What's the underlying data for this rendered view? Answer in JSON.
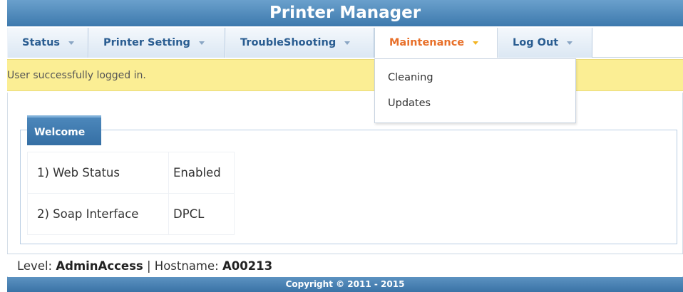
{
  "header": {
    "title": "Printer Manager"
  },
  "nav": {
    "tabs": [
      {
        "label": "Status"
      },
      {
        "label": "Printer Setting"
      },
      {
        "label": "TroubleShooting"
      },
      {
        "label": "Maintenance"
      },
      {
        "label": "Log Out"
      }
    ],
    "active_tab": "Maintenance"
  },
  "dropdown": {
    "items": [
      {
        "label": "Cleaning"
      },
      {
        "label": "Updates"
      }
    ]
  },
  "alert": {
    "message": "User successfully logged in."
  },
  "welcome": {
    "title": "Welcome",
    "rows": [
      {
        "label": "1) Web Status",
        "value": "Enabled"
      },
      {
        "label": "2) Soap Interface",
        "value": "DPCL"
      }
    ]
  },
  "statusbar": {
    "level_label": "Level:",
    "level_value": "AdminAccess",
    "separator": "|",
    "hostname_label": "Hostname:",
    "hostname_value": "A00213"
  },
  "footer": {
    "copyright": "Copyright © 2011 - 2015"
  },
  "colors": {
    "accent": "#3d79ad",
    "active_tab_text": "#e8702a",
    "alert_background": "#fbee94"
  }
}
